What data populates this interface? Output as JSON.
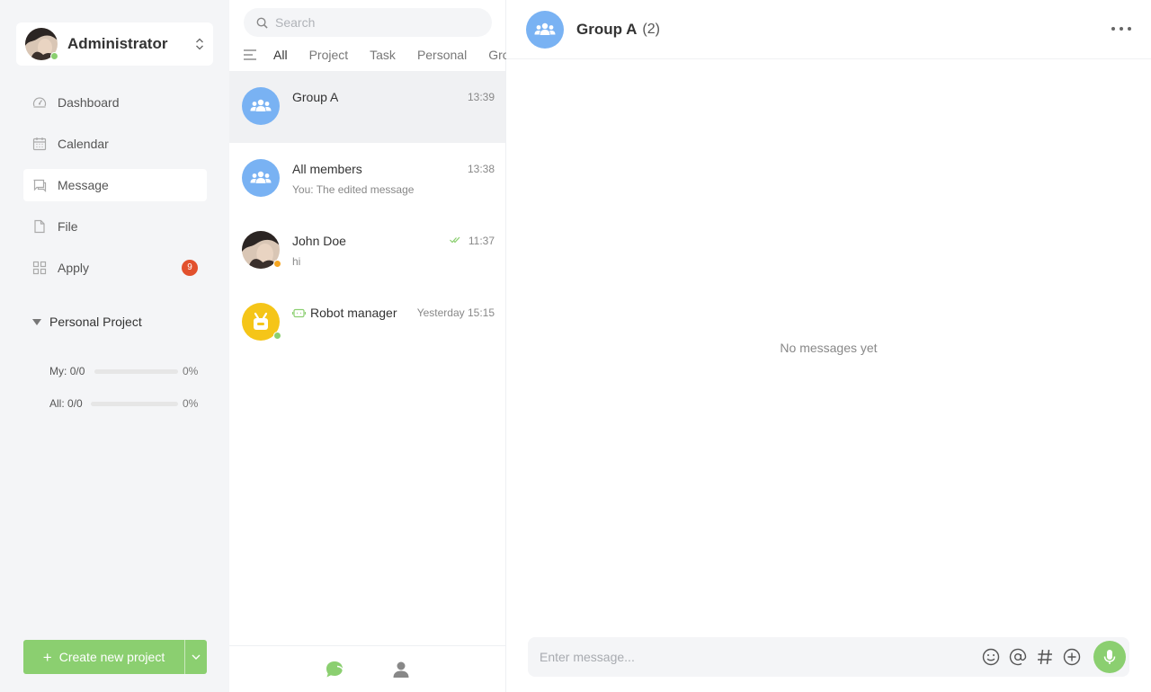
{
  "user": {
    "name": "Administrator",
    "status_color": "#8bcf70",
    "avatar_icon": "user-photo"
  },
  "nav": {
    "items": [
      {
        "label": "Dashboard",
        "icon": "dashboard-icon"
      },
      {
        "label": "Calendar",
        "icon": "calendar-icon"
      },
      {
        "label": "Message",
        "icon": "message-icon",
        "active": true
      },
      {
        "label": "File",
        "icon": "file-icon"
      },
      {
        "label": "Apply",
        "icon": "apps-icon",
        "badge": "9"
      }
    ]
  },
  "project": {
    "title": "Personal Project",
    "rows": [
      {
        "label": "My:",
        "count": "0/0",
        "pct": "0%",
        "progress": 0
      },
      {
        "label": "All:",
        "count": "0/0",
        "pct": "0%",
        "progress": 0
      }
    ]
  },
  "create_button": {
    "label": "Create new project"
  },
  "search": {
    "placeholder": "Search"
  },
  "filters": [
    "All",
    "Project",
    "Task",
    "Personal",
    "Group"
  ],
  "conversations": [
    {
      "name": "Group A",
      "time": "13:39",
      "preview": "",
      "type": "group",
      "active": true
    },
    {
      "name": "All members",
      "time": "13:38",
      "preview": "You: The edited message",
      "type": "group"
    },
    {
      "name": "John Doe",
      "time": "11:37",
      "preview": "hi",
      "type": "user",
      "status_color": "#f5a623",
      "read": true
    },
    {
      "name": "Robot manager",
      "time": "Yesterday 15:15",
      "preview": "",
      "type": "bot",
      "status_color": "#8bcf70"
    }
  ],
  "chat": {
    "title": "Group A",
    "count": "(2)",
    "empty_text": "No messages yet",
    "input_placeholder": "Enter message..."
  },
  "colors": {
    "accent": "#8bcf70",
    "group_avatar": "#79b2f3",
    "bot_avatar": "#f5c518",
    "badge": "#e2512d"
  }
}
